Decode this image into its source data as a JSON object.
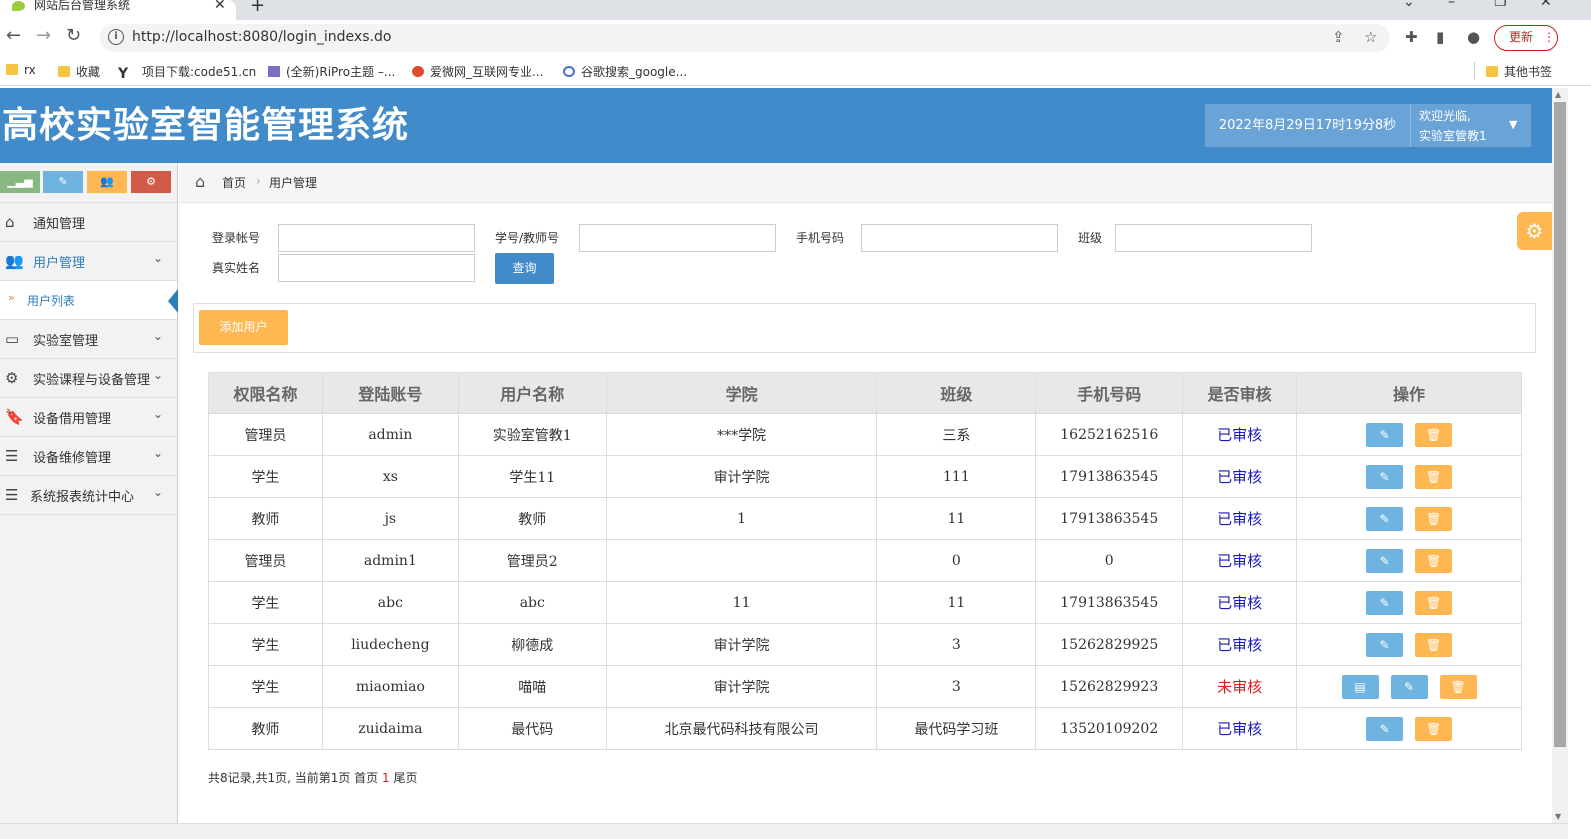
{
  "browser": {
    "tab_title": "网站后台管理系统",
    "url": "http://localhost:8080/login_indexs.do",
    "update_label": "更新",
    "bookmarks": [
      {
        "label": "rx"
      },
      {
        "label": "收藏"
      },
      {
        "label": "项目下载:code51.cn"
      },
      {
        "label": "(全新)RiPro主题 –..."
      },
      {
        "label": "爱微网_互联网专业..."
      },
      {
        "label": "谷歌搜索_google..."
      }
    ],
    "other_bookmarks": "其他书签"
  },
  "header": {
    "title": "高校实验室智能管理系统",
    "datetime": "2022年8月29日17时19分8秒",
    "welcome": "欢迎光临,",
    "username": "实验室管教1"
  },
  "sidebar": {
    "items": [
      {
        "label": "通知管理",
        "icon": "home-icon"
      },
      {
        "label": "用户管理",
        "icon": "users-icon"
      },
      {
        "label": "实验室管理",
        "icon": "desktop-icon"
      },
      {
        "label": "实验课程与设备管理",
        "icon": "gears-icon"
      },
      {
        "label": "设备借用管理",
        "icon": "bookmark-icon"
      },
      {
        "label": "设备维修管理",
        "icon": "list-icon"
      },
      {
        "label": "系统报表统计中心",
        "icon": "list-icon"
      }
    ],
    "sub_item": "用户列表"
  },
  "breadcrumb": {
    "home": "首页",
    "current": "用户管理"
  },
  "search": {
    "login_label": "登录帐号",
    "id_label": "学号/教师号",
    "phone_label": "手机号码",
    "class_label": "班级",
    "name_label": "真实姓名",
    "query_label": "查询"
  },
  "add_user_label": "添加用户",
  "table": {
    "headers": [
      "权限名称",
      "登陆账号",
      "用户名称",
      "学院",
      "班级",
      "手机号码",
      "是否审核",
      "操作"
    ],
    "rows": [
      [
        "管理员",
        "admin",
        "实验室管教1",
        "***学院",
        "三系",
        "16252162516",
        "已审核"
      ],
      [
        "学生",
        "xs",
        "学生11",
        "审计学院",
        "111",
        "17913863545",
        "已审核"
      ],
      [
        "教师",
        "js",
        "教师",
        "1",
        "11",
        "17913863545",
        "已审核"
      ],
      [
        "管理员",
        "admin1",
        "管理员2",
        "",
        "0",
        "0",
        "已审核"
      ],
      [
        "学生",
        "abc",
        "abc",
        "11",
        "11",
        "17913863545",
        "已审核"
      ],
      [
        "学生",
        "liudecheng",
        "柳德成",
        "审计学院",
        "3",
        "15262829925",
        "已审核"
      ],
      [
        "学生",
        "miaomiao",
        "喵喵",
        "审计学院",
        "3",
        "15262829923",
        "未审核"
      ],
      [
        "教师",
        "zuidaima",
        "最代码",
        "北京最代码科技有限公司",
        "最代码学习班",
        "13520109202",
        "已审核"
      ]
    ]
  },
  "pager": {
    "prefix": "共8记录,共1页, 当前第1页 首页",
    "current": "1",
    "last": "尾页"
  },
  "colors": {
    "header_bg": "#428bca",
    "approved": "#1a1ab8",
    "pending": "#d31f1f",
    "warning": "#ffb752"
  }
}
